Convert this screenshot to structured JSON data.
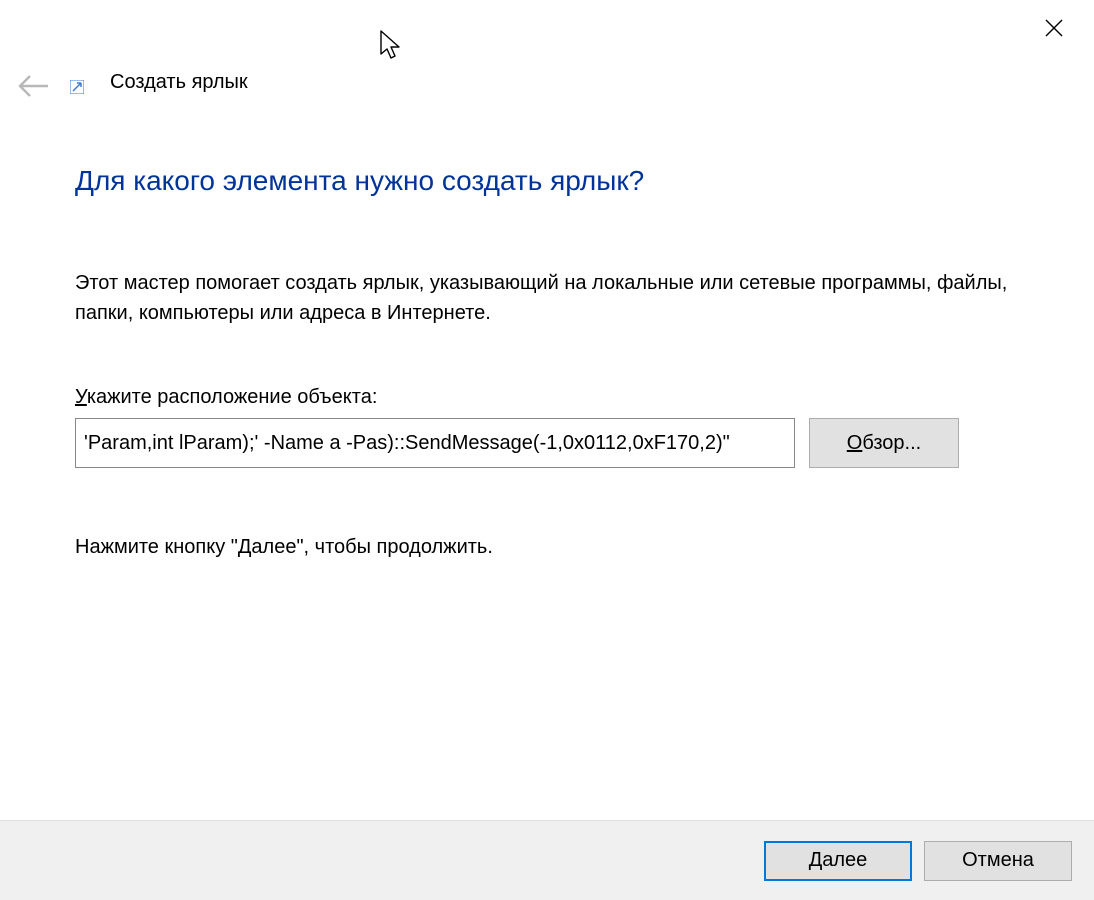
{
  "window": {
    "title": "Создать ярлык"
  },
  "main": {
    "heading": "Для какого элемента нужно создать ярлык?",
    "description": "Этот мастер помогает создать ярлык, указывающий на локальные или сетевые программы, файлы, папки, компьютеры или адреса в Интернете.",
    "field_label_prefix": "У",
    "field_label_rest": "кажите расположение объекта:",
    "location_value": "'Param,int lParam);' -Name a -Pas)::SendMessage(-1,0x0112,0xF170,2)\"",
    "browse_prefix": "О",
    "browse_rest": "бзор...",
    "instruction": "Нажмите кнопку \"Далее\", чтобы продолжить."
  },
  "footer": {
    "next_label": "Далее",
    "cancel_label": "Отмена"
  }
}
